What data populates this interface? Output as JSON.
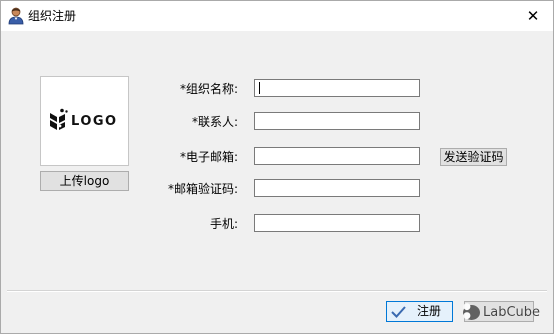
{
  "window": {
    "title": "组织注册",
    "close_glyph": "✕"
  },
  "logo": {
    "placeholder_text": "LOGO",
    "upload_label": "上传logo"
  },
  "form": {
    "org_name": {
      "label": "*组织名称:",
      "value": ""
    },
    "contact": {
      "label": "*联系人:",
      "value": ""
    },
    "email": {
      "label": "*电子邮箱:",
      "value": ""
    },
    "email_code": {
      "label": "*邮箱验证码:",
      "value": ""
    },
    "phone": {
      "label": "手机:",
      "value": ""
    },
    "send_code_label": "发送验证码"
  },
  "footer": {
    "register_label": "注册"
  },
  "watermark": {
    "text": "LabCube"
  },
  "colors": {
    "accent": "#0078d7",
    "window_bg": "#f0f0f0",
    "field_border": "#7a7a7a"
  }
}
